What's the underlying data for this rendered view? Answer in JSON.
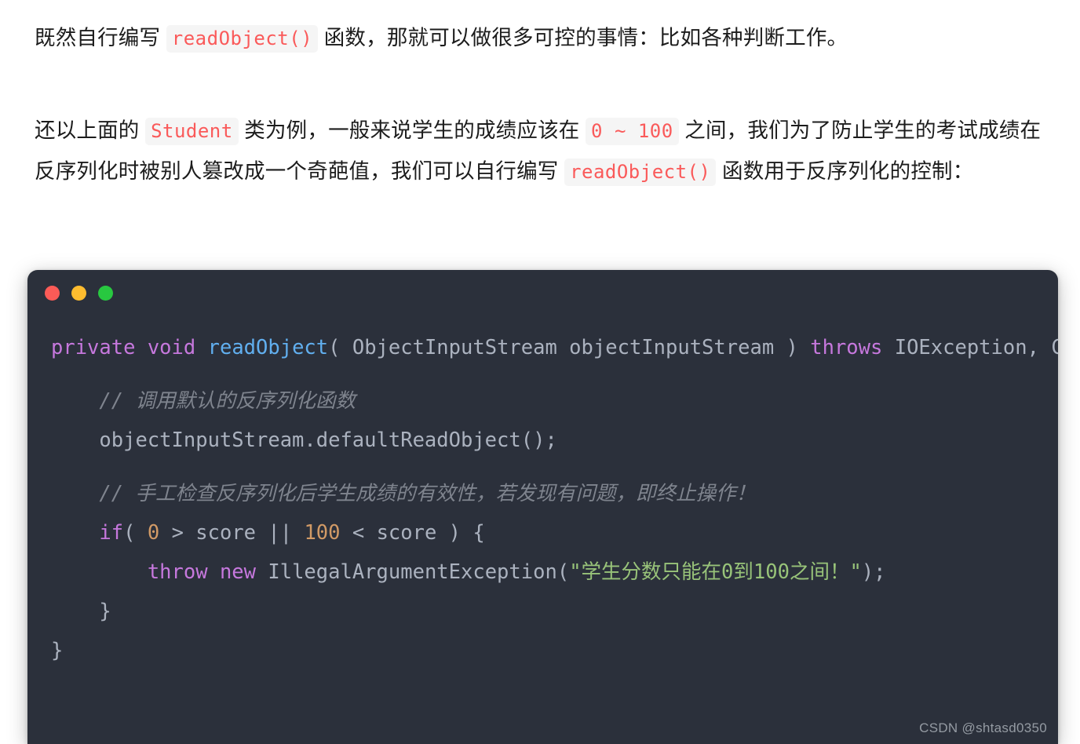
{
  "page": {
    "background": "#ffffff",
    "text_color": "#1c1c1c"
  },
  "paragraphs": [
    {
      "id": "p1",
      "segments": [
        {
          "type": "text",
          "value": "既然自行编写 "
        },
        {
          "type": "code",
          "value": "readObject()"
        },
        {
          "type": "text",
          "value": " 函数，那就可以做很多可控的事情：比如各种判断工作。"
        }
      ],
      "plain": "既然自行编写 readObject() 函数，那就可以做很多可控的事情：比如各种判断工作。"
    },
    {
      "id": "p2",
      "segments": [
        {
          "type": "text",
          "value": "还以上面的 "
        },
        {
          "type": "code",
          "value": "Student"
        },
        {
          "type": "text",
          "value": " 类为例，一般来说学生的成绩应该在 "
        },
        {
          "type": "code",
          "value": "0 ~ 100"
        },
        {
          "type": "text",
          "value": " 之间，我们为了防止学生的考试成绩在反序列化时被别人篡改成一个奇葩值，我们可以自行编写 "
        },
        {
          "type": "code",
          "value": "readObject()"
        },
        {
          "type": "text",
          "value": " 函数用于反序列化的控制："
        }
      ],
      "plain": "还以上面的 Student 类为例，一般来说学生的成绩应该在 0 ~ 100 之间，我们为了防止学生的考试成绩在反序列化时被别人篡改成一个奇葩值，我们可以自行编写 readObject() 函数用于反序列化的控制："
    }
  ],
  "inline_code_style": {
    "background": "#f5f5f5",
    "color": "#fa5a5a"
  },
  "code_window": {
    "background": "#2b303b",
    "traffic_lights": [
      {
        "name": "close-dot",
        "color": "#fc5b57"
      },
      {
        "name": "minimize-dot",
        "color": "#febc2f"
      },
      {
        "name": "maximize-dot",
        "color": "#28c840"
      }
    ],
    "language": "java",
    "token_colors": {
      "keyword": "#c678dd",
      "function": "#61afef",
      "plain": "#abb2bf",
      "number": "#d19a66",
      "string": "#98c379",
      "comment": "#7f848e"
    },
    "lines": [
      {
        "n": 1,
        "text": "private void readObject( ObjectInputStream objectInputStream ) throws IOException, ClassNotFoundException {",
        "tokens": [
          {
            "t": "private",
            "k": "keyword"
          },
          {
            "t": " ",
            "k": "plain"
          },
          {
            "t": "void",
            "k": "keyword"
          },
          {
            "t": " ",
            "k": "plain"
          },
          {
            "t": "readObject",
            "k": "function"
          },
          {
            "t": "( ObjectInputStream objectInputStream ) ",
            "k": "plain"
          },
          {
            "t": "throws",
            "k": "keyword"
          },
          {
            "t": " IOException, ClassNotFoundException {",
            "k": "plain"
          }
        ]
      },
      {
        "n": 2,
        "text": "",
        "tokens": []
      },
      {
        "n": 3,
        "text": "    // 调用默认的反序列化函数",
        "tokens": [
          {
            "t": "    ",
            "k": "plain"
          },
          {
            "t": "// 调用默认的反序列化函数",
            "k": "comment"
          }
        ]
      },
      {
        "n": 4,
        "text": "    objectInputStream.defaultReadObject();",
        "tokens": [
          {
            "t": "    objectInputStream.defaultReadObject();",
            "k": "plain"
          }
        ]
      },
      {
        "n": 5,
        "text": "",
        "tokens": []
      },
      {
        "n": 6,
        "text": "    // 手工检查反序列化后学生成绩的有效性，若发现有问题，即终止操作！",
        "tokens": [
          {
            "t": "    ",
            "k": "plain"
          },
          {
            "t": "// 手工检查反序列化后学生成绩的有效性，若发现有问题，即终止操作！",
            "k": "comment"
          }
        ]
      },
      {
        "n": 7,
        "text": "    if( 0 > score || 100 < score ) {",
        "tokens": [
          {
            "t": "    ",
            "k": "plain"
          },
          {
            "t": "if",
            "k": "keyword"
          },
          {
            "t": "( ",
            "k": "plain"
          },
          {
            "t": "0",
            "k": "number"
          },
          {
            "t": " > score || ",
            "k": "plain"
          },
          {
            "t": "100",
            "k": "number"
          },
          {
            "t": " < score ) {",
            "k": "plain"
          }
        ]
      },
      {
        "n": 8,
        "text": "        throw new IllegalArgumentException(\"学生分数只能在0到100之间！\");",
        "tokens": [
          {
            "t": "        ",
            "k": "plain"
          },
          {
            "t": "throw",
            "k": "keyword"
          },
          {
            "t": " ",
            "k": "plain"
          },
          {
            "t": "new",
            "k": "keyword"
          },
          {
            "t": " IllegalArgumentException(",
            "k": "plain"
          },
          {
            "t": "\"学生分数只能在0到100之间！\"",
            "k": "string"
          },
          {
            "t": ");",
            "k": "plain"
          }
        ]
      },
      {
        "n": 9,
        "text": "    }",
        "tokens": [
          {
            "t": "    }",
            "k": "plain"
          }
        ]
      },
      {
        "n": 10,
        "text": "}",
        "tokens": [
          {
            "t": "}",
            "k": "plain"
          }
        ]
      }
    ]
  },
  "watermark": {
    "text": "CSDN @shtasd0350"
  }
}
